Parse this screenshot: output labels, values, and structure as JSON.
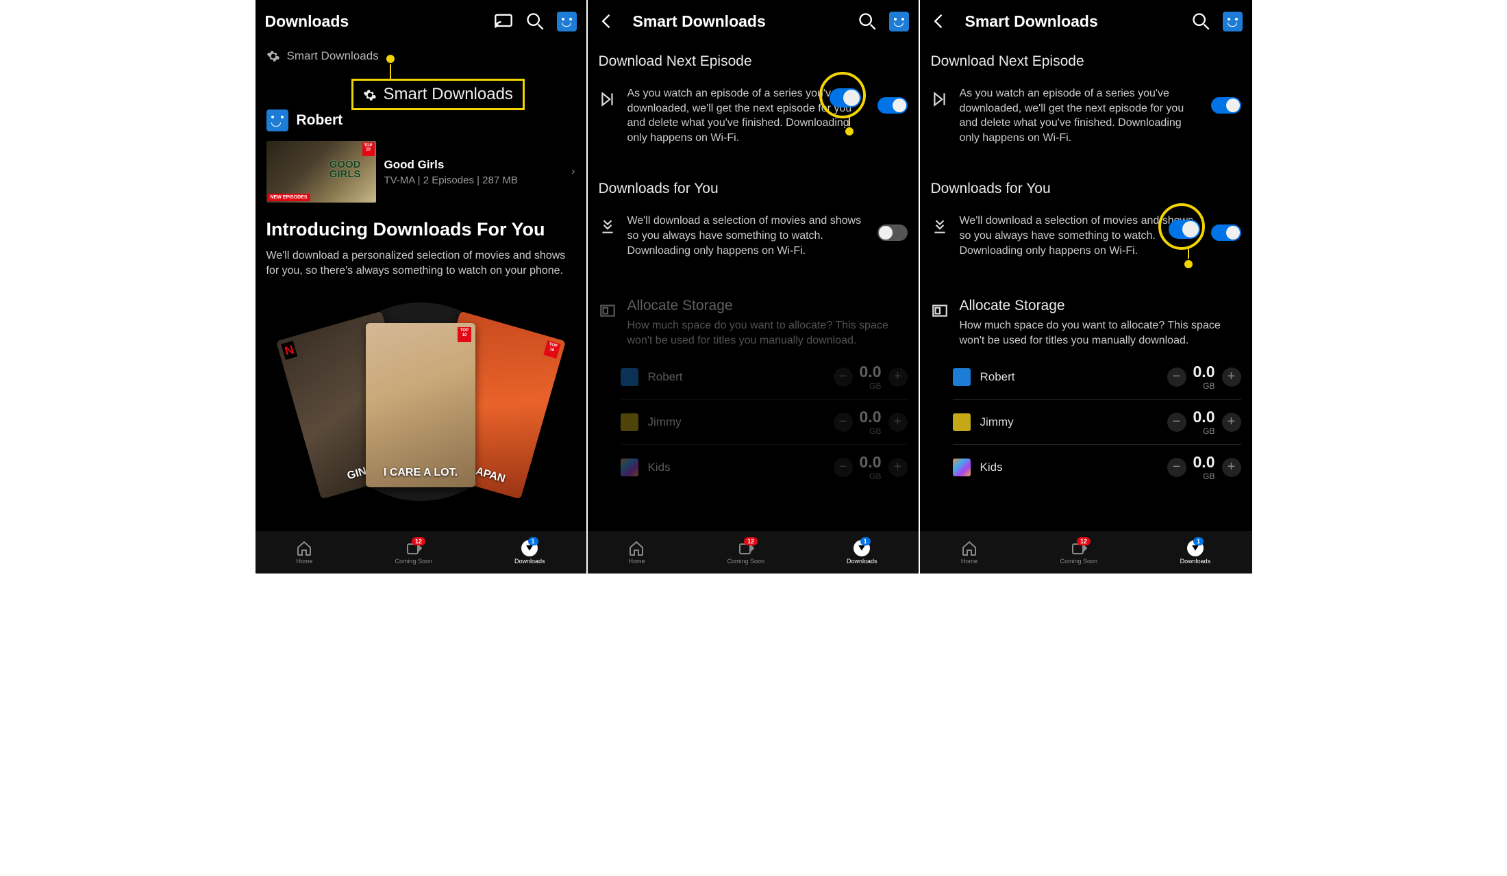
{
  "downloads": {
    "title": "Downloads",
    "smart_label": "Smart Downloads",
    "callout_label": "Smart Downloads",
    "profile_name": "Robert",
    "item": {
      "title": "Good Girls",
      "meta": "TV-MA | 2 Episodes | 287 MB",
      "top10": "TOP\n10",
      "newep": "NEW EPISODES"
    },
    "intro_title": "Introducing Downloads For You",
    "intro_body": "We'll download a personalized selection of movies and shows for you, so there's always something to watch on your phone.",
    "posters": {
      "left": "GIN\nGEO",
      "center": "I CARE A LOT.",
      "right": "MURAI\nAPAN"
    }
  },
  "settings": {
    "title": "Smart Downloads",
    "next_title": "Download Next Episode",
    "next_desc": "As you watch an episode of a series you've downloaded, we'll get the next episode for you and delete what you've finished. Downloading only happens on Wi-Fi.",
    "dfy_title": "Downloads for You",
    "dfy_desc": "We'll download a selection of movies and shows so you always have something to watch. Downloading only happens on Wi-Fi.",
    "alloc_title": "Allocate Storage",
    "alloc_desc": "How much space do you want to allocate? This space won't be used for titles you manually download.",
    "profiles": [
      {
        "name": "Robert",
        "size": "0.0",
        "unit": "GB",
        "color": "blue"
      },
      {
        "name": "Jimmy",
        "size": "0.0",
        "unit": "GB",
        "color": "yellow"
      },
      {
        "name": "Kids",
        "size": "0.0",
        "unit": "GB",
        "color": "kids"
      }
    ]
  },
  "nav": {
    "home": "Home",
    "soon": "Coming Soon",
    "downloads": "Downloads",
    "soon_badge": "12",
    "dl_badge": "1"
  }
}
